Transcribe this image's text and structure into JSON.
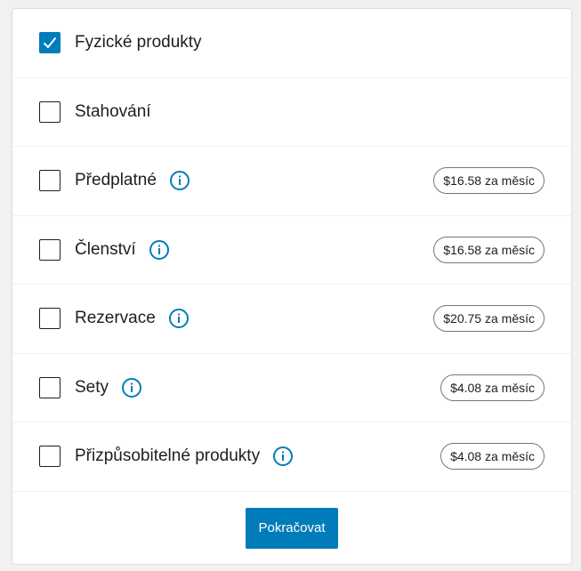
{
  "colors": {
    "accent": "#007cba",
    "text": "#1e1e1e",
    "border": "#dcdcde"
  },
  "options": [
    {
      "label": "Fyzické produkty",
      "checked": true,
      "info_icon": false,
      "price": ""
    },
    {
      "label": "Stahování",
      "checked": false,
      "info_icon": false,
      "price": ""
    },
    {
      "label": "Předplatné",
      "checked": false,
      "info_icon": true,
      "price": "$16.58 za měsíc"
    },
    {
      "label": "Členství",
      "checked": false,
      "info_icon": true,
      "price": "$16.58 za měsíc"
    },
    {
      "label": "Rezervace",
      "checked": false,
      "info_icon": true,
      "price": "$20.75 za měsíc"
    },
    {
      "label": "Sety",
      "checked": false,
      "info_icon": true,
      "price": "$4.08 za měsíc"
    },
    {
      "label": "Přizpůsobitelné produkty",
      "checked": false,
      "info_icon": true,
      "price": "$4.08 za měsíc"
    }
  ],
  "continue_label": "Pokračovat"
}
